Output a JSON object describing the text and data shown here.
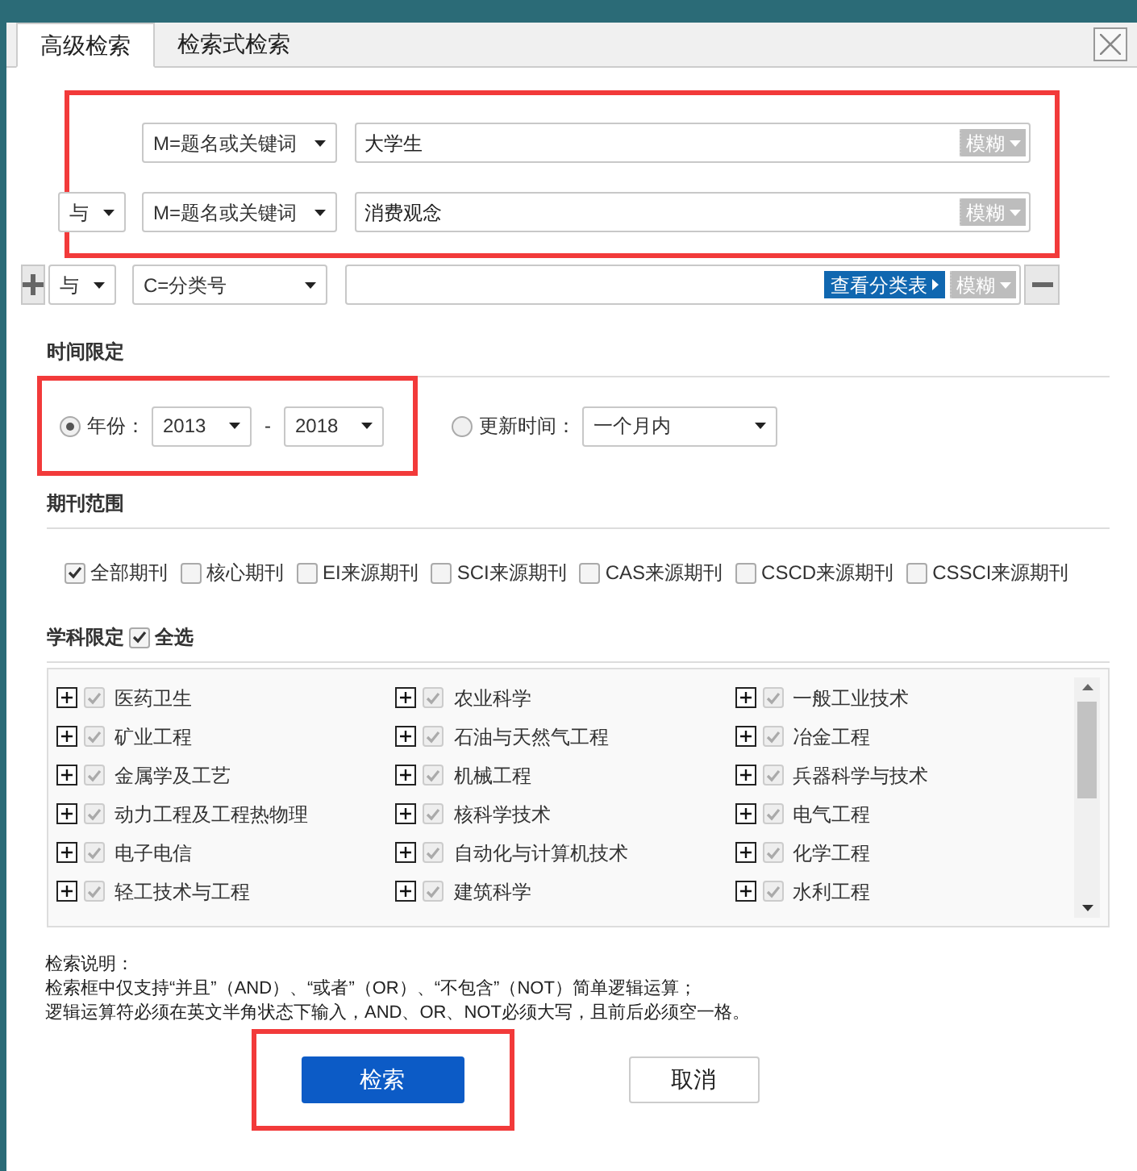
{
  "tabs": [
    {
      "label": "高级检索",
      "selected": true
    },
    {
      "label": "检索式检索",
      "selected": false
    }
  ],
  "conditions_highlighted": true,
  "conditions": [
    {
      "field": "M=题名或关键词",
      "value": "大学生",
      "match": "模糊",
      "kind": "plain"
    },
    {
      "logic": "与",
      "field": "M=题名或关键词",
      "value": "消费观念",
      "match": "模糊",
      "kind": "plain"
    },
    {
      "logic": "与",
      "field": "C=分类号",
      "match": "模糊",
      "kind": "classification",
      "link": "查看分类表"
    }
  ],
  "time": {
    "title": "时间限定",
    "year_highlighted": true,
    "year": {
      "label": "年份：",
      "selected": true,
      "from": "2013",
      "separator": "-",
      "to": "2018"
    },
    "update": {
      "label": "更新时间：",
      "selected": false,
      "value": "一个月内"
    }
  },
  "journals": {
    "title": "期刊范围",
    "items": [
      {
        "label": "全部期刊",
        "checked": true
      },
      {
        "label": "核心期刊",
        "checked": false
      },
      {
        "label": "EI来源期刊",
        "checked": false
      },
      {
        "label": "SCI来源期刊",
        "checked": false
      },
      {
        "label": "CAS来源期刊",
        "checked": false
      },
      {
        "label": "CSCD来源期刊",
        "checked": false
      },
      {
        "label": "CSSCI来源期刊",
        "checked": false
      }
    ]
  },
  "subjects": {
    "title": "学科限定",
    "select_all": {
      "label": "全选",
      "checked": true
    },
    "items": [
      {
        "label": "医药卫生",
        "checked": true
      },
      {
        "label": "农业科学",
        "checked": true
      },
      {
        "label": "一般工业技术",
        "checked": true
      },
      {
        "label": "矿业工程",
        "checked": true
      },
      {
        "label": "石油与天然气工程",
        "checked": true
      },
      {
        "label": "冶金工程",
        "checked": true
      },
      {
        "label": "金属学及工艺",
        "checked": true
      },
      {
        "label": "机械工程",
        "checked": true
      },
      {
        "label": "兵器科学与技术",
        "checked": true
      },
      {
        "label": "动力工程及工程热物理",
        "checked": true
      },
      {
        "label": "核科学技术",
        "checked": true
      },
      {
        "label": "电气工程",
        "checked": true
      },
      {
        "label": "电子电信",
        "checked": true
      },
      {
        "label": "自动化与计算机技术",
        "checked": true
      },
      {
        "label": "化学工程",
        "checked": true
      },
      {
        "label": "轻工技术与工程",
        "checked": true
      },
      {
        "label": "建筑科学",
        "checked": true
      },
      {
        "label": "水利工程",
        "checked": true
      }
    ]
  },
  "notes": [
    "检索说明：",
    "检索框中仅支持“并且”（AND）、“或者”（OR）、“不包含”（NOT）简单逻辑运算；",
    "逻辑运算符必须在英文半角状态下输入，AND、OR、NOT必须大写，且前后必须空一格。"
  ],
  "buttons": [
    {
      "label": "检索",
      "kind": "primary",
      "highlighted": true
    },
    {
      "label": "取消",
      "kind": "secondary",
      "highlighted": false
    }
  ]
}
